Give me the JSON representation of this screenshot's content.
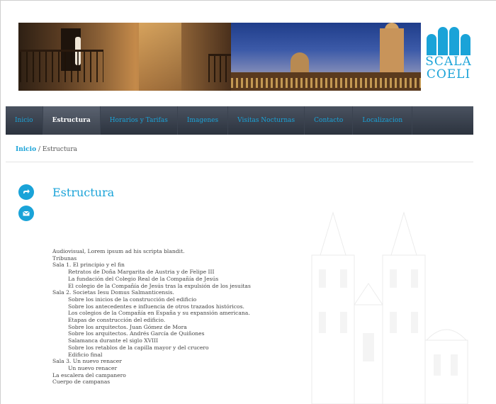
{
  "logo": {
    "line1": "SCALA",
    "line2": "COELI"
  },
  "nav": {
    "items": [
      {
        "label": "Inicio",
        "active": false
      },
      {
        "label": "Estructura",
        "active": true
      },
      {
        "label": "Horarios y Tarifas",
        "active": false
      },
      {
        "label": "Imagenes",
        "active": false
      },
      {
        "label": "Visitas Nocturnas",
        "active": false
      },
      {
        "label": "Contacto",
        "active": false
      },
      {
        "label": "Localizacion",
        "active": false
      }
    ]
  },
  "breadcrumb": {
    "home": "Inicio",
    "separator": "/",
    "current": "Estructura"
  },
  "share": {
    "icons": [
      "share-icon",
      "email-icon"
    ]
  },
  "page": {
    "title": "Estructura"
  },
  "content": {
    "lines": [
      "Audiovisual, Lorem ipsum ad his scripta blandit.",
      "Tribunas",
      "Sala 1. El principio y el fin",
      "Retratos de Doña Margarita de Austria y de Felipe III",
      "La fundación del Colegio Real de la Compañía de Jesús",
      "El colegio de la Compañía de Jesús tras la expulsión de los jesuitas",
      "Sala 2. Societas Iesu Domus Salmanticensis.",
      "Sobre los inicios de la construcción del edificio",
      "Sobre los antecedentes e influencia de otros trazados históricos.",
      "Los colegios de la Compañía en España y su expansión americana.",
      "Etapas de construcción del edificio.",
      "Sobre los arquitectos. Juan Gómez de Mora",
      "Sobre los arquitectos. Andrés García de Quiñones",
      "Salamanca durante el siglo XVIII",
      "Sobre los retablos de la capilla mayor y del crucero",
      "Edificio final",
      "Sala 3. Un nuevo renacer",
      "Un nuevo renacer",
      "La escalera del campanero",
      "Cuerpo de campanas"
    ]
  },
  "colors": {
    "accent": "#1aa3d8",
    "nav_bg": "#2c333e"
  }
}
